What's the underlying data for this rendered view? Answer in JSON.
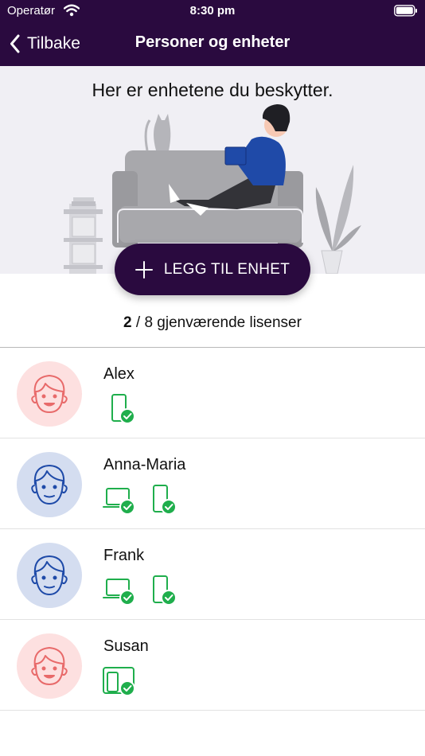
{
  "status_bar": {
    "carrier": "Operatør",
    "time": "8:30 pm"
  },
  "nav": {
    "back_label": "Tilbake",
    "title": "Personer og enheter"
  },
  "hero": {
    "title": "Her er enhetene du beskytter."
  },
  "add_button": {
    "label": "LEGG TIL ENHET"
  },
  "licenses": {
    "used": "2",
    "rest": " / 8 gjenværende lisenser"
  },
  "persons": [
    {
      "name": "Alex",
      "avatar_color": "#fde0e0",
      "icon_color": "#e86a6a",
      "devices": [
        "phone-protected-icon"
      ]
    },
    {
      "name": "Anna-Maria",
      "avatar_color": "#d4ddf0",
      "icon_color": "#1e4aa8",
      "devices": [
        "laptop-protected-icon",
        "phone-protected-icon"
      ]
    },
    {
      "name": "Frank",
      "avatar_color": "#d4ddf0",
      "icon_color": "#1e4aa8",
      "devices": [
        "laptop-protected-icon",
        "phone-protected-icon"
      ]
    },
    {
      "name": "Susan",
      "avatar_color": "#fde0e0",
      "icon_color": "#e86a6a",
      "devices": [
        "tablet-protected-icon"
      ]
    }
  ],
  "colors": {
    "brand": "#2a0a3f",
    "device_ok": "#1fae4c",
    "hero_bg": "#f0eff4"
  }
}
